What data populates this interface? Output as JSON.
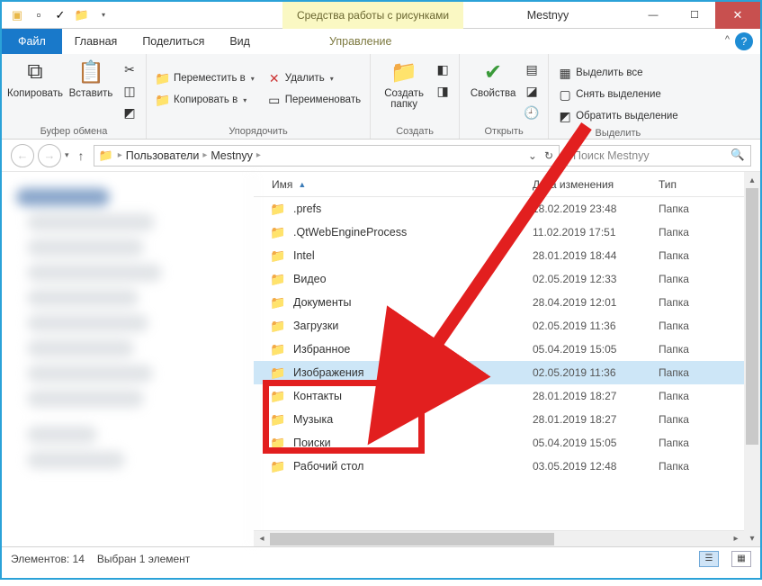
{
  "context_tab": "Средства работы с рисунками",
  "window_title": "Mestnyy",
  "tabs": {
    "file": "Файл",
    "home": "Главная",
    "share": "Поделиться",
    "view": "Вид",
    "manage": "Управление"
  },
  "ribbon": {
    "clipboard": {
      "label": "Буфер обмена",
      "copy": "Копировать",
      "paste": "Вставить"
    },
    "organize": {
      "label": "Упорядочить",
      "move": "Переместить в",
      "copyto": "Копировать в",
      "delete": "Удалить",
      "rename": "Переименовать"
    },
    "new": {
      "label": "Создать",
      "newfolder": "Создать папку"
    },
    "open": {
      "label": "Открыть",
      "properties": "Свойства"
    },
    "select": {
      "label": "Выделить",
      "all": "Выделить все",
      "none": "Снять выделение",
      "invert": "Обратить выделение"
    }
  },
  "path": {
    "seg1": "Пользователи",
    "seg2": "Mestnyy"
  },
  "search_placeholder": "Поиск Mestnyy",
  "columns": {
    "name": "Имя",
    "date": "Дата изменения",
    "type": "Тип"
  },
  "type_folder": "Папка",
  "rows": [
    {
      "name": ".prefs",
      "date": "18.02.2019 23:48"
    },
    {
      "name": ".QtWebEngineProcess",
      "date": "11.02.2019 17:51"
    },
    {
      "name": "Intel",
      "date": "28.01.2019 18:44"
    },
    {
      "name": "Видео",
      "date": "02.05.2019 12:33"
    },
    {
      "name": "Документы",
      "date": "28.04.2019 12:01"
    },
    {
      "name": "Загрузки",
      "date": "02.05.2019 11:36"
    },
    {
      "name": "Избранное",
      "date": "05.04.2019 15:05"
    },
    {
      "name": "Изображения",
      "date": "02.05.2019 11:36"
    },
    {
      "name": "Контакты",
      "date": "28.01.2019 18:27"
    },
    {
      "name": "Музыка",
      "date": "28.01.2019 18:27"
    },
    {
      "name": "Поиски",
      "date": "05.04.2019 15:05"
    },
    {
      "name": "Рабочий стол",
      "date": "03.05.2019 12:48"
    }
  ],
  "status": {
    "items": "Элементов: 14",
    "selected": "Выбран 1 элемент"
  }
}
